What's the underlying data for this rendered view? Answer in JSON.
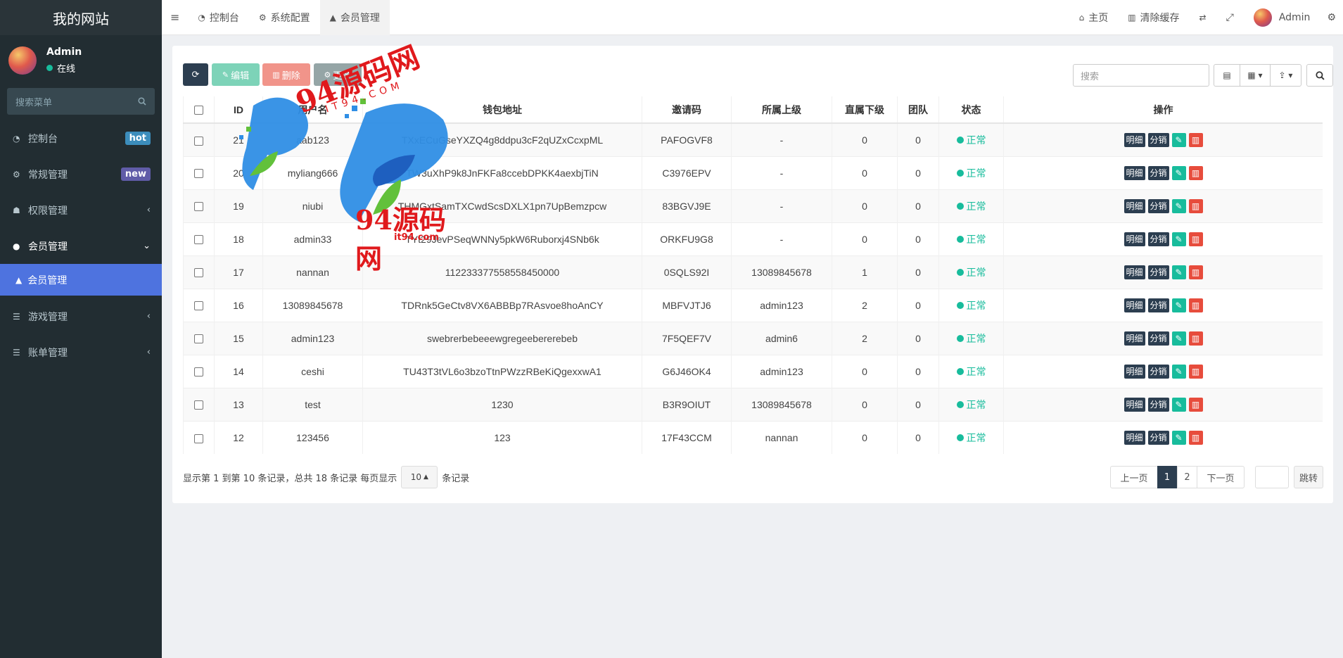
{
  "sidebar": {
    "site_title": "我的网站",
    "user": {
      "name": "Admin",
      "status": "在线"
    },
    "search_placeholder": "搜索菜单",
    "items": [
      {
        "label": "控制台",
        "badge": "hot",
        "icon": "dashboard-icon"
      },
      {
        "label": "常规管理",
        "badge": "new",
        "icon": "cogs-icon"
      },
      {
        "label": "权限管理",
        "icon": "group-icon",
        "arrow": "‹"
      },
      {
        "label": "会员管理",
        "icon": "user-circle-icon",
        "arrow": "⌄"
      },
      {
        "label": "游戏管理",
        "icon": "list-icon",
        "arrow": "‹"
      },
      {
        "label": "账单管理",
        "icon": "list-icon",
        "arrow": "‹"
      }
    ],
    "active_sub": "会员管理"
  },
  "topbar": {
    "tabs": [
      "控制台",
      "系统配置",
      "会员管理"
    ],
    "home": "主页",
    "clear_cache": "清除缓存",
    "admin": "Admin"
  },
  "toolbar": {
    "edit": "编辑",
    "delete": "删除",
    "more": "更多",
    "search_placeholder": "搜索"
  },
  "table": {
    "headers": [
      "ID",
      "用户名",
      "钱包地址",
      "邀请码",
      "所属上级",
      "直属下级",
      "团队",
      "状态",
      "操作"
    ],
    "op_detail": "明细",
    "op_fx": "分销",
    "rows": [
      {
        "id": "21",
        "user": "aab123",
        "wallet": "TXxECuGseYXZQ4g8ddpu3cF2qUZxCcxpML",
        "code": "PAFOGVF8",
        "parent": "-",
        "direct": "0",
        "team": "0",
        "status": "正常"
      },
      {
        "id": "20",
        "user": "myliang666",
        "wallet": "TW3uXhP9k8JnFKFa8ccebDPKK4aexbjTiN",
        "code": "C3976EPV",
        "parent": "-",
        "direct": "0",
        "team": "0",
        "status": "正常"
      },
      {
        "id": "19",
        "user": "niubi",
        "wallet": "THMGxtSamTXCwdScsDXLX1pn7UpBemzpcw",
        "code": "83BGVJ9E",
        "parent": "-",
        "direct": "0",
        "team": "0",
        "status": "正常"
      },
      {
        "id": "18",
        "user": "admin33",
        "wallet": "TYt29JevPSeqWNNy5pkW6Ruborxj4SNb6k",
        "code": "ORKFU9G8",
        "parent": "-",
        "direct": "0",
        "team": "0",
        "status": "正常"
      },
      {
        "id": "17",
        "user": "nannan",
        "wallet": "112233377558558450000",
        "code": "0SQLS92I",
        "parent": "13089845678",
        "direct": "1",
        "team": "0",
        "status": "正常"
      },
      {
        "id": "16",
        "user": "13089845678",
        "wallet": "TDRnk5GeCtv8VX6ABBBp7RAsvoe8hoAnCY",
        "code": "MBFVJTJ6",
        "parent": "admin123",
        "direct": "2",
        "team": "0",
        "status": "正常"
      },
      {
        "id": "15",
        "user": "admin123",
        "wallet": "swebrerbebeeewgregeebererebeb",
        "code": "7F5QEF7V",
        "parent": "admin6",
        "direct": "2",
        "team": "0",
        "status": "正常"
      },
      {
        "id": "14",
        "user": "ceshi",
        "wallet": "TU43T3tVL6o3bzoTtnPWzzRBeKiQgexxwA1",
        "code": "G6J46OK4",
        "parent": "admin123",
        "direct": "0",
        "team": "0",
        "status": "正常"
      },
      {
        "id": "13",
        "user": "test",
        "wallet": "1230",
        "code": "B3R9OIUT",
        "parent": "13089845678",
        "direct": "0",
        "team": "0",
        "status": "正常"
      },
      {
        "id": "12",
        "user": "123456",
        "wallet": "123",
        "code": "17F43CCM",
        "parent": "nannan",
        "direct": "0",
        "team": "0",
        "status": "正常"
      }
    ]
  },
  "footer": {
    "info_prefix": "显示第 1 到第 10 条记录，总共 18 条记录 每页显示",
    "page_size": "10",
    "info_suffix": "条记录",
    "prev": "上一页",
    "pages": [
      "1",
      "2"
    ],
    "next": "下一页",
    "jump": "跳转"
  },
  "watermark": {
    "text": "94源码网",
    "domain": "it94.com",
    "arc_text": "IT94.COM"
  },
  "colors": {
    "sidebar": "#222d32",
    "active": "#4e73df",
    "success": "#18bc9c",
    "danger": "#e74c3c",
    "dark": "#2c3e50"
  }
}
